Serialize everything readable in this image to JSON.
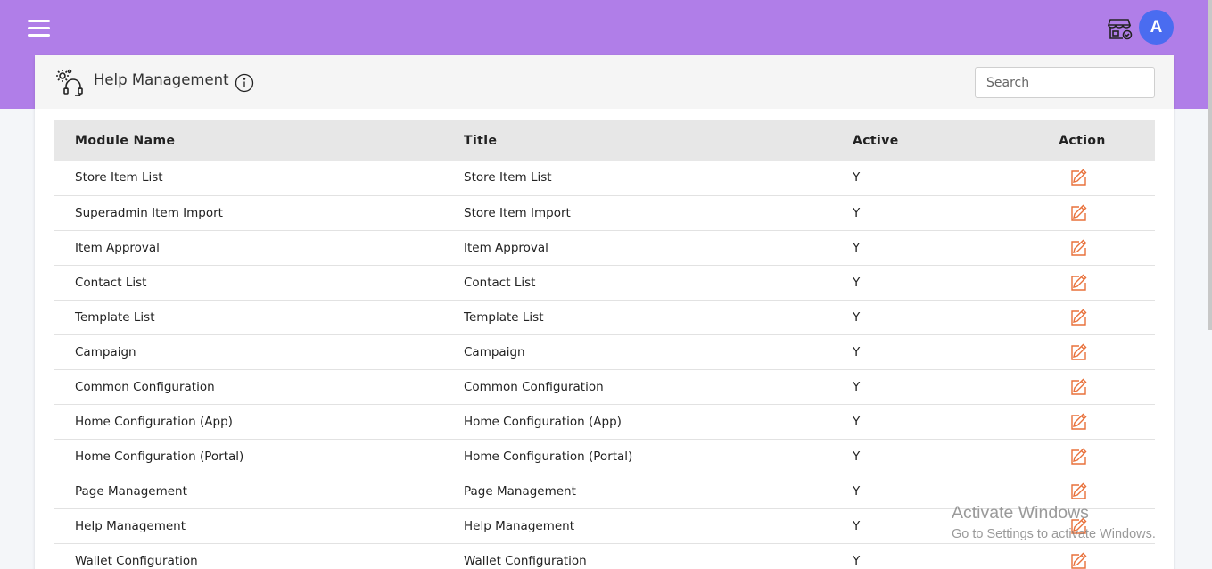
{
  "header": {
    "menu_icon": "hamburger-menu-icon",
    "store_icon": "store-settings-icon",
    "avatar_initial": "A",
    "avatar_color": "#4a6cf0",
    "bar_color": "#b07ee8"
  },
  "page": {
    "title": "Help Management",
    "title_icon": "gear-headset-icon",
    "info_icon": "info-icon",
    "search_placeholder": "Search"
  },
  "table": {
    "columns": {
      "module": "Module Name",
      "title": "Title",
      "active": "Active",
      "action": "Action"
    },
    "rows": [
      {
        "module": "Store Item List",
        "title": "Store Item List",
        "active": "Y"
      },
      {
        "module": "Superadmin Item Import",
        "title": "Store Item Import",
        "active": "Y"
      },
      {
        "module": "Item Approval",
        "title": "Item Approval",
        "active": "Y"
      },
      {
        "module": "Contact List",
        "title": "Contact List",
        "active": "Y"
      },
      {
        "module": "Template List",
        "title": "Template List",
        "active": "Y"
      },
      {
        "module": "Campaign",
        "title": "Campaign",
        "active": "Y"
      },
      {
        "module": "Common Configuration",
        "title": "Common Configuration",
        "active": "Y"
      },
      {
        "module": "Home Configuration (App)",
        "title": "Home Configuration (App)",
        "active": "Y"
      },
      {
        "module": "Home Configuration (Portal)",
        "title": "Home Configuration (Portal)",
        "active": "Y"
      },
      {
        "module": "Page Management",
        "title": "Page Management",
        "active": "Y"
      },
      {
        "module": "Help Management",
        "title": "Help Management",
        "active": "Y"
      },
      {
        "module": "Wallet Configuration",
        "title": "Wallet Configuration",
        "active": "Y"
      }
    ],
    "action_icon": "edit-icon",
    "action_color": "#e8703a"
  },
  "watermark": {
    "title": "Activate Windows",
    "subtitle": "Go to Settings to activate Windows."
  }
}
